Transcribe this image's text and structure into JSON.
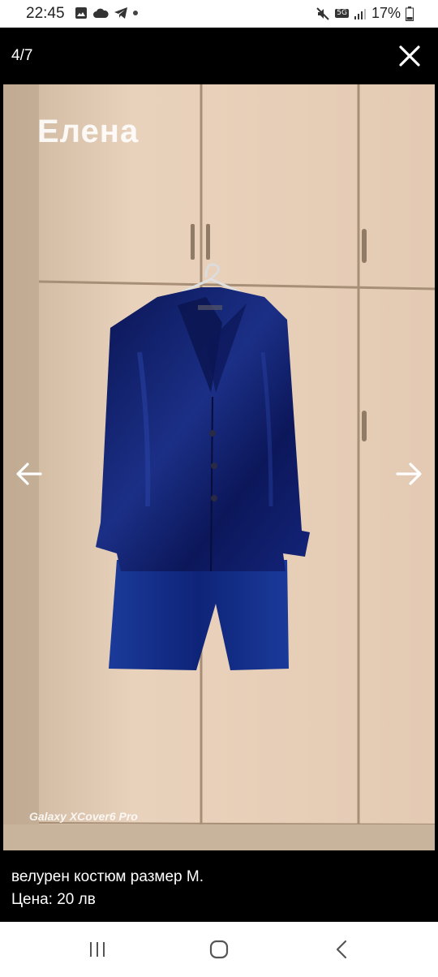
{
  "status_bar": {
    "time": "22:45",
    "left_icons": [
      "image-icon",
      "cloud-icon",
      "telegram-icon",
      "dot-icon"
    ],
    "network_badge": "5G",
    "battery": "17%",
    "right_icons": [
      "mute-icon",
      "network-5g-icon",
      "signal-icon",
      "battery-icon"
    ]
  },
  "viewer": {
    "counter": "4/7",
    "close_icon": "close-icon",
    "prev_icon": "arrow-left-icon",
    "next_icon": "arrow-right-icon"
  },
  "photo": {
    "watermark": "Елена",
    "camera_mark": "Galaxy XCover6 Pro",
    "subject": "blue velvet suit on hanger"
  },
  "caption": {
    "line1": "велурен костюм размер М.",
    "line2": "Цена: 20 лв"
  },
  "nav_bar": {
    "recents_icon": "recents-icon",
    "home_icon": "home-icon",
    "back_icon": "back-icon"
  },
  "colors": {
    "background": "#000000",
    "wardrobe": "#e6cdb6",
    "velvet": "#15297a"
  }
}
